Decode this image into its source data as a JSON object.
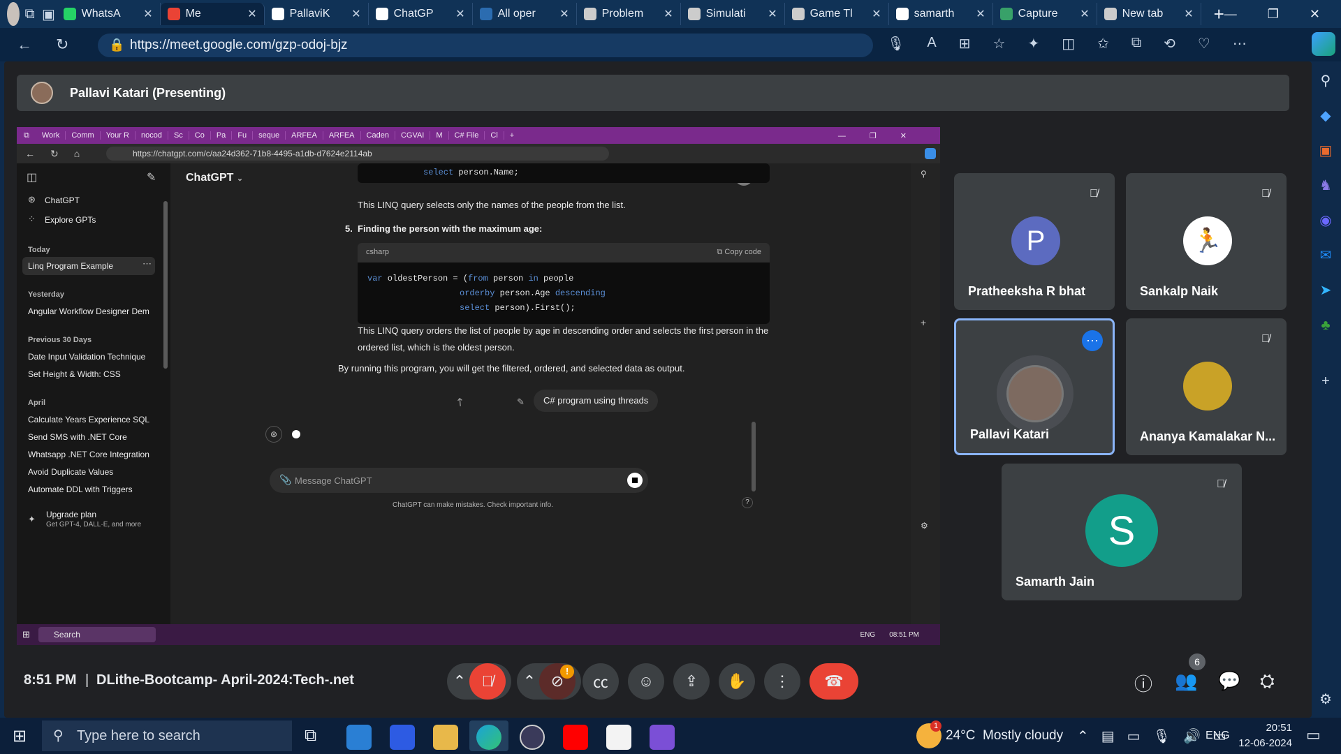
{
  "browser": {
    "tabs": [
      {
        "label": "WhatsA",
        "color": "#25d366"
      },
      {
        "label": "Me",
        "color": "#ea4335",
        "active": true
      },
      {
        "label": "PallaviK",
        "color": "#ffffff"
      },
      {
        "label": "ChatGP",
        "color": "#ffffff"
      },
      {
        "label": "All oper",
        "color": "#2b6cb0"
      },
      {
        "label": "Problem",
        "color": "#cccccc"
      },
      {
        "label": "Simulati",
        "color": "#cccccc"
      },
      {
        "label": "Game Tl",
        "color": "#cccccc"
      },
      {
        "label": "samarth",
        "color": "#ffffff"
      },
      {
        "label": "Capture",
        "color": "#38a169"
      },
      {
        "label": "New tab",
        "color": "#cccccc"
      }
    ],
    "url": "https://meet.google.com/gzp-odoj-bjz"
  },
  "meet": {
    "presenter_label": "Pallavi Katari (Presenting)",
    "clock": "8:51 PM",
    "separator": "|",
    "meeting_name": "DLithe-Bootcamp- April-2024:Tech-.net",
    "participant_count": "6",
    "camera_alert": "!"
  },
  "shared": {
    "tabs": [
      "Work",
      "Comm",
      "Your R",
      "nocod",
      "Sc",
      "Co",
      "Pa",
      "Fu",
      "seque",
      "ARFEA",
      "ARFEA",
      "Caden",
      "CGVAI",
      "M",
      "C# File",
      "Cl"
    ],
    "url": "https://chatgpt.com/c/aa24d362-71b8-4495-a1db-d7624e2114ab",
    "app_title": "ChatGPT",
    "sidebar": {
      "chatgpt": "ChatGPT",
      "explore": "Explore GPTs",
      "today_label": "Today",
      "today_items": [
        "Linq Program Example"
      ],
      "yesterday_label": "Yesterday",
      "yesterday_items": [
        "Angular Workflow Designer Dem"
      ],
      "prev30_label": "Previous 30 Days",
      "prev30_items": [
        "Date Input Validation Technique",
        "Set Height & Width: CSS"
      ],
      "april_label": "April",
      "april_items": [
        "Calculate Years Experience SQL",
        "Send SMS with .NET Core",
        "Whatsapp .NET Core Integration",
        "Avoid Duplicate Values",
        "Automate DDL with Triggers"
      ],
      "upgrade_title": "Upgrade plan",
      "upgrade_sub": "Get GPT-4, DALL·E, and more"
    },
    "chat": {
      "code1_kw": "select",
      "code1_rest": " person.Name;",
      "para1": "This LINQ query selects only the names of the people from the list.",
      "step_num": "5.",
      "step_title": "Finding the person with the maximum age:",
      "code_lang": "csharp",
      "copy_label": "Copy code",
      "code2": [
        {
          "kw": "var",
          "rest": " oldestPerson = (",
          "kw2": "from",
          "rest2": " person ",
          "kw3": "in",
          "rest3": " people"
        },
        {
          "kw": "orderby",
          "rest": " person.Age ",
          "kw2": "descending",
          "rest2": "",
          "kw3": "",
          "rest3": ""
        },
        {
          "kw": "select",
          "rest": " person).First();",
          "kw2": "",
          "rest2": "",
          "kw3": "",
          "rest3": ""
        }
      ],
      "para2": "This LINQ query orders the list of people by age in descending order and selects the first person in the ordered list, which is the oldest person.",
      "para3": "By running this program, you will get the filtered, ordered, and selected data as output.",
      "user_msg": "C# program using threads",
      "input_placeholder": "Message ChatGPT",
      "disclaimer": "ChatGPT can make mistakes. Check important info.",
      "help": "?"
    },
    "taskbar": {
      "search": "Search",
      "lang": "ENG",
      "time": "08:51 PM"
    }
  },
  "participants": [
    {
      "name": "Pratheeksha R bhat",
      "initial": "P",
      "color": "#5c6bc0",
      "muted": true
    },
    {
      "name": "Sankalp Naik",
      "initial": "",
      "color": "#ffffff",
      "muted": true
    },
    {
      "name": "Pallavi Katari",
      "initial": "",
      "color": "#7d6a60",
      "muted": false,
      "active": true
    },
    {
      "name": "Ananya Kamalakar N...",
      "initial": "",
      "color": "#c9a227",
      "muted": true
    },
    {
      "name": "Samarth Jain",
      "initial": "S",
      "color": "#129e8a",
      "muted": true
    }
  ],
  "windows": {
    "search_placeholder": "Type here to search",
    "weather": "24°C  Mostly cloudy",
    "weather_badge": "1",
    "lang": "ENG",
    "time": "20:51",
    "date": "12-06-2024"
  }
}
